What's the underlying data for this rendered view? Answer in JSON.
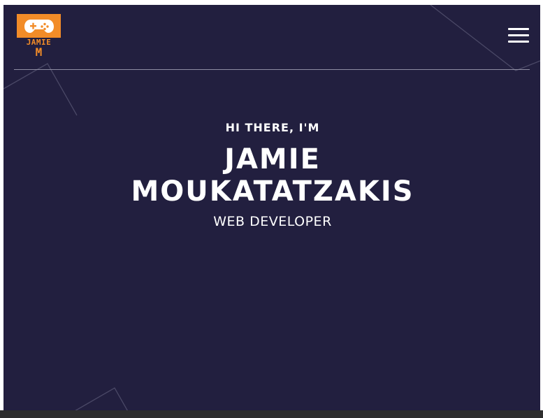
{
  "logo": {
    "line1": "JAMIE",
    "line2": "M",
    "icon": "gamepad-icon",
    "color": "#f28c28"
  },
  "header": {
    "menu_icon": "hamburger-menu-icon"
  },
  "hero": {
    "greeting": "HI THERE, I'M",
    "name_line1": "JAMIE",
    "name_line2": "MOUKATATZAKIS",
    "role": "WEB DEVELOPER"
  },
  "colors": {
    "background": "#221f3f",
    "accent": "#f28c28",
    "text": "#ffffff",
    "decorative_lines": "#4a4866"
  }
}
